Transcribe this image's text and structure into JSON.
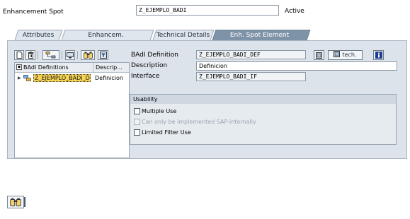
{
  "header": {
    "label": "Enhancement Spot",
    "value": "Z_EJEMPLO_BADI",
    "status": "Active"
  },
  "tabs": [
    {
      "label": "Attributes",
      "active": false
    },
    {
      "label": "Enhancem. Implementations",
      "active": false
    },
    {
      "label": "Technical Details",
      "active": false
    },
    {
      "label": "Enh. Spot Element Definitions",
      "active": true
    }
  ],
  "toolbar": {
    "icons": [
      "create-icon",
      "delete-icon",
      "hierarchy-icon",
      "display-icon",
      "find-icon",
      "filter-icon"
    ]
  },
  "tree": {
    "col1": "BAdI Definitions",
    "col2": "Descrip...",
    "rows": [
      {
        "name": "Z_EJEMPLO_BADI_DEF",
        "description": "Definicion"
      }
    ]
  },
  "form": {
    "badi_definition_label": "BAdI Definition",
    "badi_definition_value": "Z_EJEMPLO_BADI_DEF",
    "tech_button": "tech.",
    "description_label": "Description",
    "description_value": "Definicion",
    "interface_label": "Interface",
    "interface_value": "Z_EJEMPLO_BADI_IF"
  },
  "usability": {
    "title": "Usability",
    "options": [
      {
        "label": "Multiple Use",
        "checked": false,
        "enabled": true
      },
      {
        "label": "Can only be implemented SAP-internally",
        "checked": false,
        "enabled": false
      },
      {
        "label": "Limited Filter Use",
        "checked": false,
        "enabled": true
      }
    ]
  },
  "colors": {
    "panel": "#dde3ea",
    "active_tab": "#7f93a8",
    "tree_selection": "#f6d352",
    "info_blue": "#1a3c8f"
  }
}
